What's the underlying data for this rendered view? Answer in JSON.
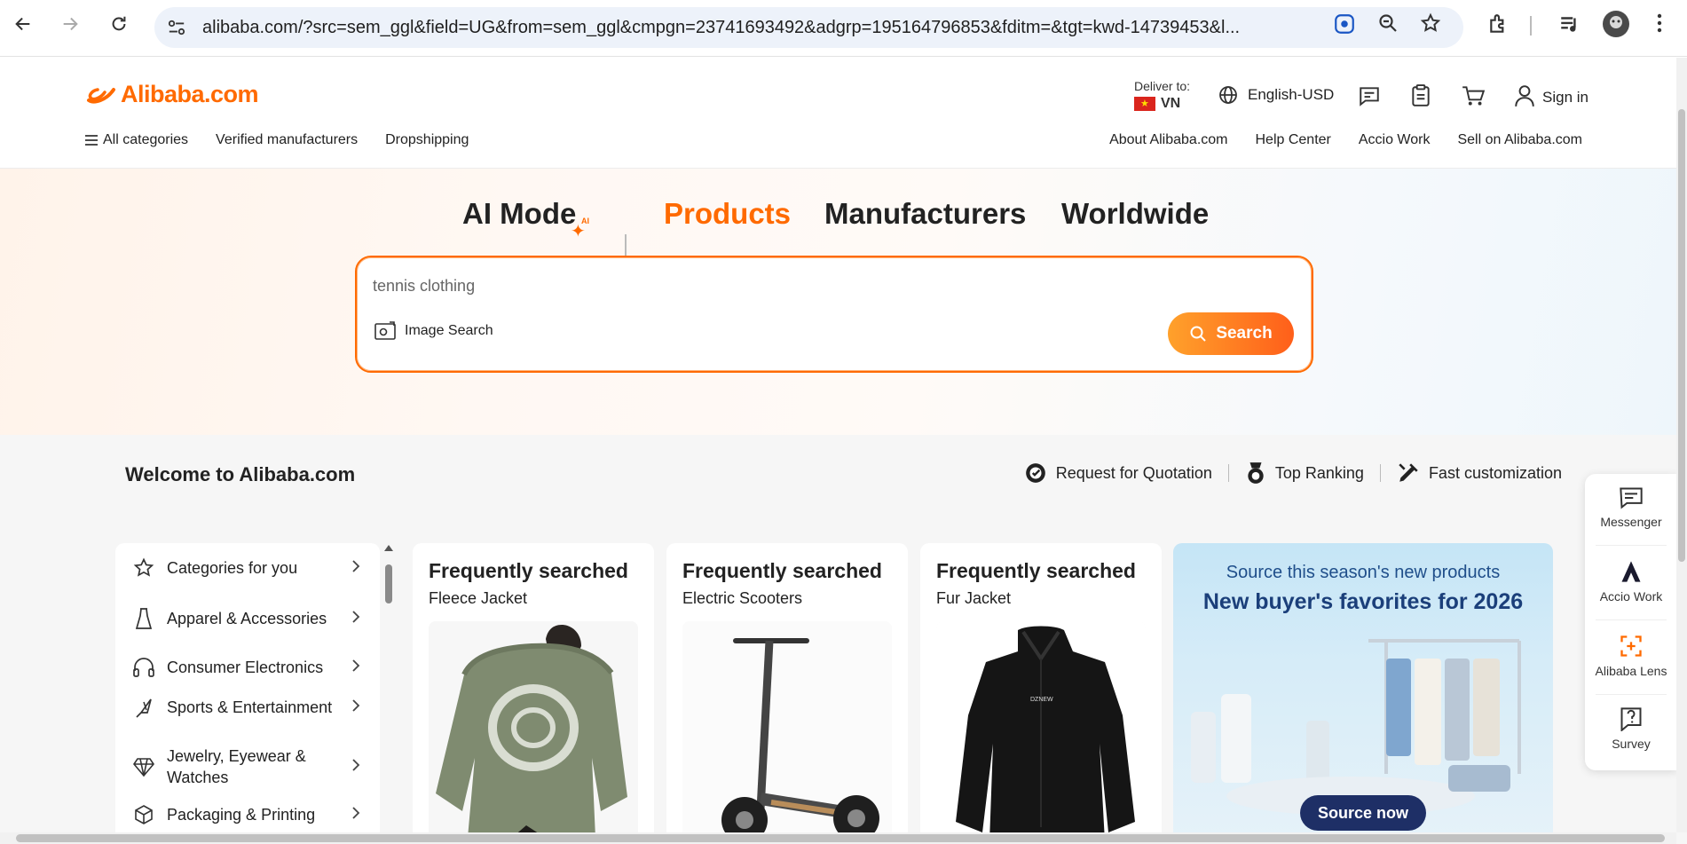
{
  "browser": {
    "url": "alibaba.com/?src=sem_ggl&field=UG&from=sem_ggl&cmpgn=23741693492&adgrp=195164796853&fditm=&tgt=kwd-14739453&l..."
  },
  "header": {
    "logo_text": "Alibaba.com",
    "deliver_label": "Deliver to:",
    "deliver_country": "VN",
    "language": "English-USD",
    "signin": "Sign in",
    "subnav_left": [
      "All categories",
      "Verified manufacturers",
      "Dropshipping"
    ],
    "subnav_right": [
      "About Alibaba.com",
      "Help Center",
      "Accio Work",
      "Sell on Alibaba.com"
    ]
  },
  "hero": {
    "tabs": [
      "AI Mode",
      "Products",
      "Manufacturers",
      "Worldwide"
    ],
    "ai_badge": "AI",
    "active_tab": "Products",
    "search_value": "tennis clothing",
    "image_search": "Image Search",
    "search_button": "Search"
  },
  "welcome": {
    "title": "Welcome to Alibaba.com",
    "quick_links": [
      "Request for Quotation",
      "Top Ranking",
      "Fast customization"
    ]
  },
  "categories": [
    {
      "label": "Categories for you",
      "icon": "star-icon"
    },
    {
      "label": "Apparel & Accessories",
      "icon": "dress-icon"
    },
    {
      "label": "Consumer Electronics",
      "icon": "headphones-icon"
    },
    {
      "label": "Sports & Entertainment",
      "icon": "badminton-icon"
    },
    {
      "label": "Jewelry, Eyewear & Watches",
      "icon": "diamond-icon"
    },
    {
      "label": "Packaging & Printing",
      "icon": "box-icon"
    }
  ],
  "cards": [
    {
      "title": "Frequently searched",
      "subtitle": "Fleece Jacket"
    },
    {
      "title": "Frequently searched",
      "subtitle": "Electric Scooters"
    },
    {
      "title": "Frequently searched",
      "subtitle": "Fur Jacket"
    }
  ],
  "promo": {
    "line1": "Source this season's new products",
    "line2": "New buyer's favorites for 2026",
    "button": "Source now"
  },
  "float_panel": [
    "Messenger",
    "Accio Work",
    "Alibaba Lens",
    "Survey"
  ],
  "colors": {
    "accent": "#ff6a00",
    "promo_button": "#1e2f66"
  }
}
